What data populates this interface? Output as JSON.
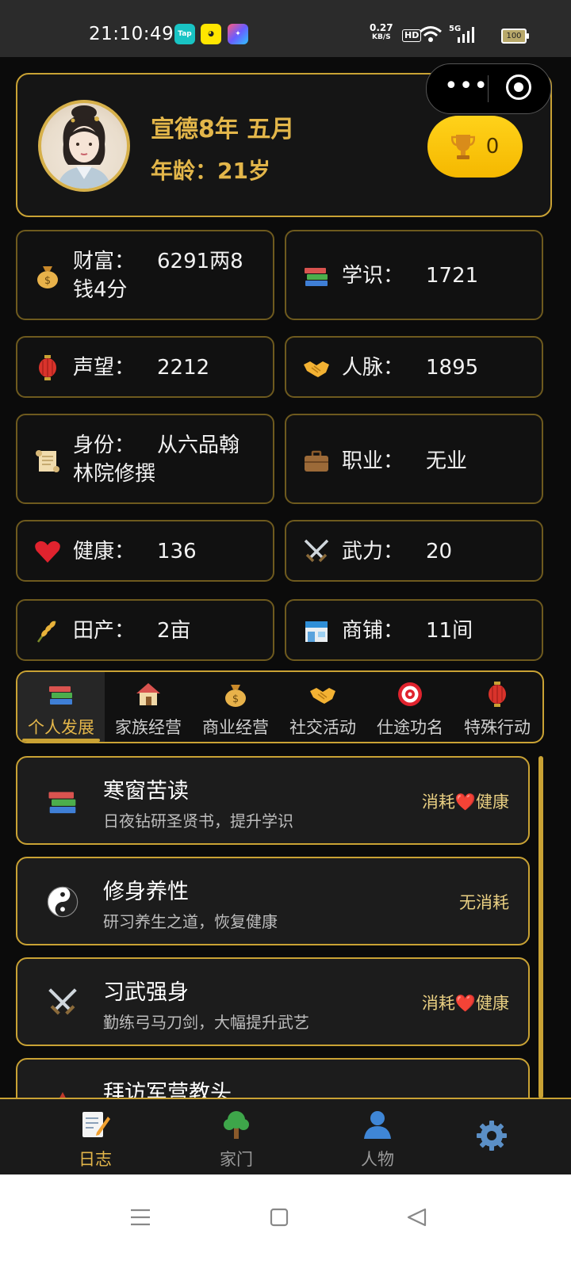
{
  "status_bar": {
    "time": "21:10:49",
    "apps": [
      "Tap",
      "",
      ""
    ],
    "network_speed": "0.27",
    "network_unit": "KB/S",
    "hd": "HD",
    "signal": "5G",
    "battery": "100"
  },
  "profile": {
    "date": "宣德8年 五月",
    "age": "年龄：21岁",
    "trophy_count": "0"
  },
  "stats": [
    {
      "label": "财富：",
      "value": "6291两8钱4分",
      "icon": "money-bag-icon"
    },
    {
      "label": "学识：",
      "value": "1721",
      "icon": "books-icon"
    },
    {
      "label": "声望：",
      "value": "2212",
      "icon": "lantern-icon"
    },
    {
      "label": "人脉：",
      "value": "1895",
      "icon": "handshake-icon"
    },
    {
      "label": "身份：",
      "value": "从六品翰林院修撰",
      "icon": "scroll-icon"
    },
    {
      "label": "职业：",
      "value": "无业",
      "icon": "briefcase-icon"
    },
    {
      "label": "健康：",
      "value": "136",
      "icon": "heart-icon"
    },
    {
      "label": "武力：",
      "value": "20",
      "icon": "crossed-swords-icon"
    },
    {
      "label": "田产：",
      "value": "2亩",
      "icon": "rice-icon"
    },
    {
      "label": "商铺：",
      "value": "11间",
      "icon": "store-icon"
    }
  ],
  "tabs": [
    {
      "label": "个人发展",
      "icon": "books-icon",
      "active": true
    },
    {
      "label": "家族经营",
      "icon": "house-icon"
    },
    {
      "label": "商业经营",
      "icon": "money-bag-icon"
    },
    {
      "label": "社交活动",
      "icon": "handshake-icon"
    },
    {
      "label": "仕途功名",
      "icon": "target-icon"
    },
    {
      "label": "特殊行动",
      "icon": "lantern-icon"
    }
  ],
  "actions": [
    {
      "title": "寒窗苦读",
      "desc": "日夜钻研圣贤书，提升学识",
      "cost": "消耗❤️健康",
      "icon": "books-icon"
    },
    {
      "title": "修身养性",
      "desc": "研习养生之道，恢复健康",
      "cost": "无消耗",
      "icon": "yin-yang-icon"
    },
    {
      "title": "习武强身",
      "desc": "勤练弓马刀剑，大幅提升武艺",
      "cost": "消耗❤️健康",
      "icon": "crossed-swords-icon"
    },
    {
      "title": "拜访军营教头",
      "desc": "",
      "cost": "",
      "icon": "camp-icon"
    }
  ],
  "bottom_nav": [
    {
      "label": "日志",
      "icon": "memo-icon",
      "active": true
    },
    {
      "label": "家门",
      "icon": "tree-icon"
    },
    {
      "label": "人物",
      "icon": "person-icon"
    },
    {
      "label": "",
      "icon": "gear-icon"
    }
  ],
  "colors": {
    "gold": "#c9a234",
    "gold_text": "#e3b64a",
    "trophy_yellow": "#ffd21a"
  }
}
